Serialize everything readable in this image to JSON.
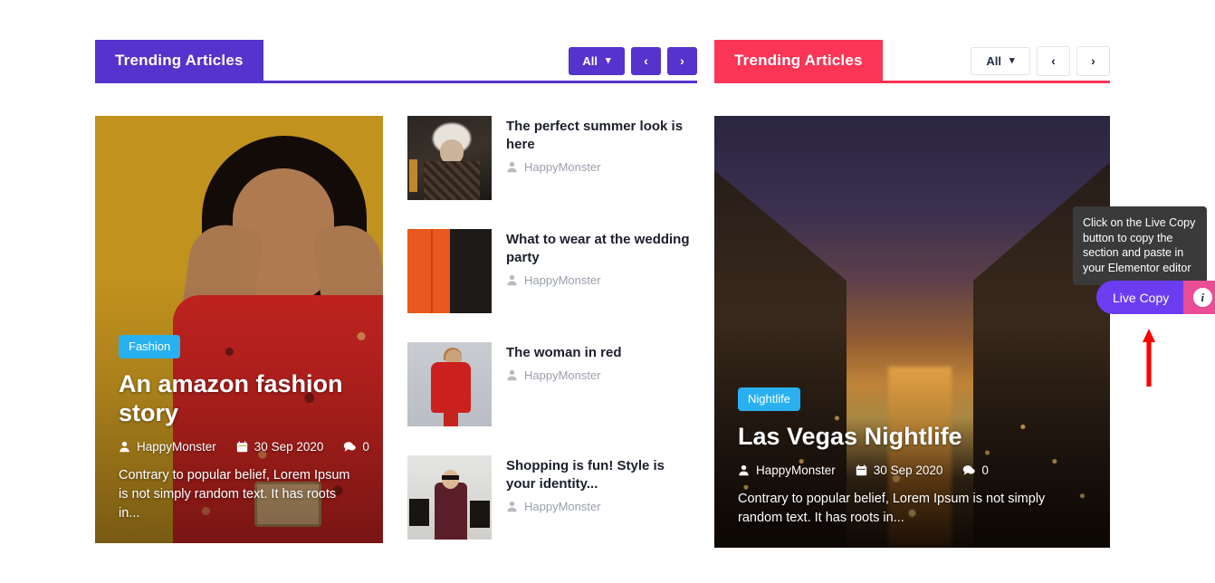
{
  "panels": [
    {
      "id": "left",
      "header": {
        "title": "Trending Articles",
        "filter_label": "All",
        "prev_label": "‹",
        "next_label": "›",
        "accent": "#5533cc",
        "style": "filled"
      },
      "feature": {
        "category": "Fashion",
        "title": "An amazon fashion story",
        "author": "HappyMonster",
        "date": "30 Sep 2020",
        "comments": "0",
        "excerpt": "Contrary to popular belief, Lorem Ipsum is not simply random text. It has roots in...",
        "badge_color": "#29b0f0",
        "image_alt": "Woman in red floral dress on mustard background"
      },
      "list": [
        {
          "title": "The perfect summer look is here",
          "author": "HappyMonster",
          "thumb": "thumb-smoke"
        },
        {
          "title": "What to wear at the wedding party",
          "author": "HappyMonster",
          "thumb": "thumb-orange"
        },
        {
          "title": "The woman in red",
          "author": "HappyMonster",
          "thumb": "thumb-red"
        },
        {
          "title": "Shopping is fun! Style is your identity...",
          "author": "HappyMonster",
          "thumb": "thumb-shop"
        }
      ]
    },
    {
      "id": "right",
      "header": {
        "title": "Trending Articles",
        "filter_label": "All",
        "prev_label": "‹",
        "next_label": "›",
        "accent": "#fa3556",
        "style": "outlined"
      },
      "feature": {
        "category": "Nightlife",
        "title": "Las Vegas Nightlife",
        "author": "HappyMonster",
        "date": "30 Sep 2020",
        "comments": "0",
        "excerpt": "Contrary to popular belief, Lorem Ipsum is not simply random text. It has roots in...",
        "badge_color": "#29b0f0",
        "image_alt": "Canal lined with buildings and string lights at sunset"
      }
    }
  ],
  "overlay": {
    "tooltip_text": "Click on the Live Copy button to copy the section and paste in your Elementor editor",
    "live_copy_label": "Live Copy",
    "info_glyph": "i",
    "arrow_color": "#ff0000",
    "button_color": "#6c3df0",
    "info_color": "#e84d96"
  }
}
